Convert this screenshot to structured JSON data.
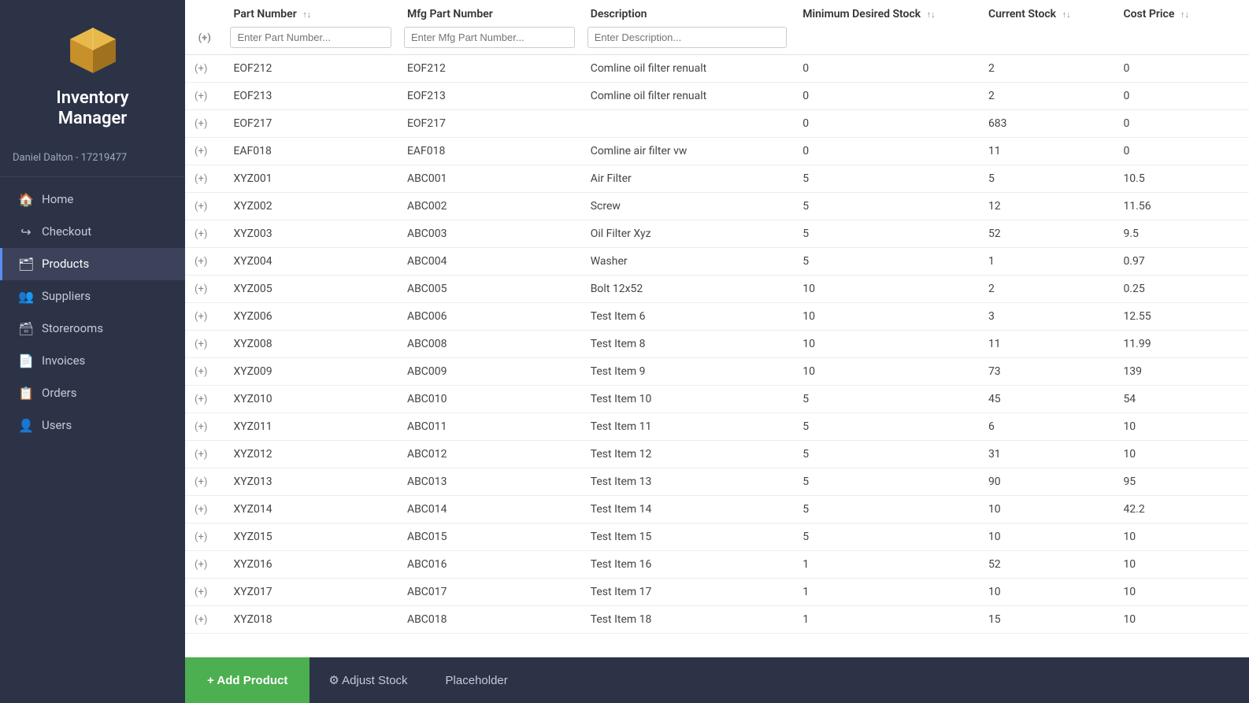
{
  "app": {
    "title_line1": "Inventory",
    "title_line2": "Manager"
  },
  "user": {
    "label": "Daniel Dalton - 17219477"
  },
  "nav": {
    "items": [
      {
        "id": "home",
        "label": "Home",
        "icon": "🏠",
        "active": false
      },
      {
        "id": "checkout",
        "label": "Checkout",
        "icon": "↪",
        "active": false
      },
      {
        "id": "products",
        "label": "Products",
        "icon": "🗂",
        "active": true
      },
      {
        "id": "suppliers",
        "label": "Suppliers",
        "icon": "👥",
        "active": false
      },
      {
        "id": "storerooms",
        "label": "Storerooms",
        "icon": "🗃",
        "active": false
      },
      {
        "id": "invoices",
        "label": "Invoices",
        "icon": "📄",
        "active": false
      },
      {
        "id": "orders",
        "label": "Orders",
        "icon": "📋",
        "active": false
      },
      {
        "id": "users",
        "label": "Users",
        "icon": "👤",
        "active": false
      }
    ]
  },
  "table": {
    "columns": [
      {
        "id": "expand",
        "label": ""
      },
      {
        "id": "part_number",
        "label": "Part Number",
        "sortable": true
      },
      {
        "id": "mfg_part_number",
        "label": "Mfg Part Number",
        "sortable": false
      },
      {
        "id": "description",
        "label": "Description",
        "sortable": false
      },
      {
        "id": "min_desired_stock",
        "label": "Minimum Desired Stock",
        "sortable": true
      },
      {
        "id": "current_stock",
        "label": "Current Stock",
        "sortable": true
      },
      {
        "id": "cost_price",
        "label": "Cost Price",
        "sortable": true
      }
    ],
    "filters": {
      "part_number_placeholder": "Enter Part Number...",
      "mfg_part_number_placeholder": "Enter Mfg Part Number...",
      "description_placeholder": "Enter Description..."
    },
    "rows": [
      {
        "expand": "(+)",
        "part_number": "EOF212",
        "mfg_part_number": "EOF212",
        "description": "Comline oil filter renualt",
        "min_desired_stock": "0",
        "current_stock": "2",
        "cost_price": "0"
      },
      {
        "expand": "(+)",
        "part_number": "EOF213",
        "mfg_part_number": "EOF213",
        "description": "Comline oil filter renualt",
        "min_desired_stock": "0",
        "current_stock": "2",
        "cost_price": "0"
      },
      {
        "expand": "(+)",
        "part_number": "EOF217",
        "mfg_part_number": "EOF217",
        "description": "",
        "min_desired_stock": "0",
        "current_stock": "683",
        "cost_price": "0"
      },
      {
        "expand": "(+)",
        "part_number": "EAF018",
        "mfg_part_number": "EAF018",
        "description": "Comline air filter vw",
        "min_desired_stock": "0",
        "current_stock": "11",
        "cost_price": "0"
      },
      {
        "expand": "(+)",
        "part_number": "XYZ001",
        "mfg_part_number": "ABC001",
        "description": "Air Filter",
        "min_desired_stock": "5",
        "current_stock": "5",
        "cost_price": "10.5"
      },
      {
        "expand": "(+)",
        "part_number": "XYZ002",
        "mfg_part_number": "ABC002",
        "description": "Screw",
        "min_desired_stock": "5",
        "current_stock": "12",
        "cost_price": "11.56"
      },
      {
        "expand": "(+)",
        "part_number": "XYZ003",
        "mfg_part_number": "ABC003",
        "description": "Oil Filter Xyz",
        "min_desired_stock": "5",
        "current_stock": "52",
        "cost_price": "9.5"
      },
      {
        "expand": "(+)",
        "part_number": "XYZ004",
        "mfg_part_number": "ABC004",
        "description": "Washer",
        "min_desired_stock": "5",
        "current_stock": "1",
        "cost_price": "0.97"
      },
      {
        "expand": "(+)",
        "part_number": "XYZ005",
        "mfg_part_number": "ABC005",
        "description": "Bolt 12x52",
        "min_desired_stock": "10",
        "current_stock": "2",
        "cost_price": "0.25"
      },
      {
        "expand": "(+)",
        "part_number": "XYZ006",
        "mfg_part_number": "ABC006",
        "description": "Test Item 6",
        "min_desired_stock": "10",
        "current_stock": "3",
        "cost_price": "12.55"
      },
      {
        "expand": "(+)",
        "part_number": "XYZ008",
        "mfg_part_number": "ABC008",
        "description": "Test Item 8",
        "min_desired_stock": "10",
        "current_stock": "11",
        "cost_price": "11.99"
      },
      {
        "expand": "(+)",
        "part_number": "XYZ009",
        "mfg_part_number": "ABC009",
        "description": "Test Item 9",
        "min_desired_stock": "10",
        "current_stock": "73",
        "cost_price": "139"
      },
      {
        "expand": "(+)",
        "part_number": "XYZ010",
        "mfg_part_number": "ABC010",
        "description": "Test Item 10",
        "min_desired_stock": "5",
        "current_stock": "45",
        "cost_price": "54"
      },
      {
        "expand": "(+)",
        "part_number": "XYZ011",
        "mfg_part_number": "ABC011",
        "description": "Test Item 11",
        "min_desired_stock": "5",
        "current_stock": "6",
        "cost_price": "10"
      },
      {
        "expand": "(+)",
        "part_number": "XYZ012",
        "mfg_part_number": "ABC012",
        "description": "Test Item 12",
        "min_desired_stock": "5",
        "current_stock": "31",
        "cost_price": "10"
      },
      {
        "expand": "(+)",
        "part_number": "XYZ013",
        "mfg_part_number": "ABC013",
        "description": "Test Item 13",
        "min_desired_stock": "5",
        "current_stock": "90",
        "cost_price": "95"
      },
      {
        "expand": "(+)",
        "part_number": "XYZ014",
        "mfg_part_number": "ABC014",
        "description": "Test Item 14",
        "min_desired_stock": "5",
        "current_stock": "10",
        "cost_price": "42.2"
      },
      {
        "expand": "(+)",
        "part_number": "XYZ015",
        "mfg_part_number": "ABC015",
        "description": "Test Item 15",
        "min_desired_stock": "5",
        "current_stock": "10",
        "cost_price": "10"
      },
      {
        "expand": "(+)",
        "part_number": "XYZ016",
        "mfg_part_number": "ABC016",
        "description": "Test Item 16",
        "min_desired_stock": "1",
        "current_stock": "52",
        "cost_price": "10"
      },
      {
        "expand": "(+)",
        "part_number": "XYZ017",
        "mfg_part_number": "ABC017",
        "description": "Test Item 17",
        "min_desired_stock": "1",
        "current_stock": "10",
        "cost_price": "10"
      },
      {
        "expand": "(+)",
        "part_number": "XYZ018",
        "mfg_part_number": "ABC018",
        "description": "Test Item 18",
        "min_desired_stock": "1",
        "current_stock": "15",
        "cost_price": "10"
      }
    ]
  },
  "bottomBar": {
    "add_product_label": "+ Add Product",
    "adjust_stock_label": "⚙ Adjust Stock",
    "placeholder_label": "Placeholder"
  }
}
